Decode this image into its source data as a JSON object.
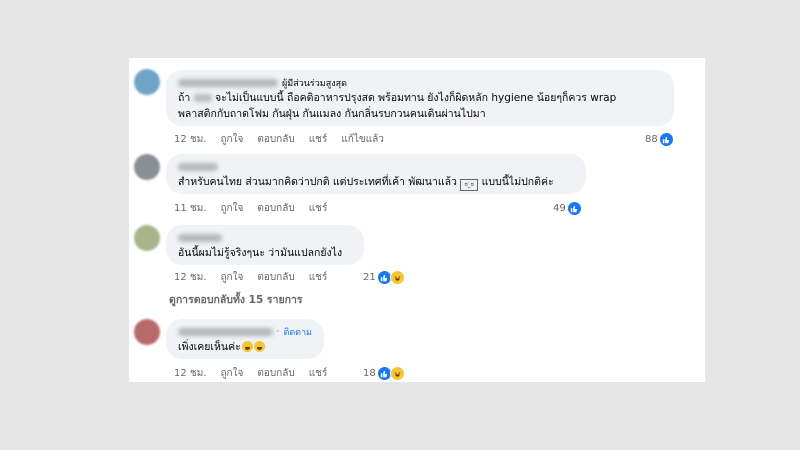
{
  "comments": [
    {
      "badge": "ผู้มีส่วนร่วมสูงสุด",
      "line1_prefix": "ถ้า",
      "line1_suffix": "จะไม่เป็นแบบนี้ ถือคติอาหารปรุงสด พร้อมทาน ยังไงก็ผิดหลัก hygiene น้อยๆก็ควร wrap",
      "line2": "พลาสติกกับถาดโฟม กันฝุ่น กันแมลง กันกลิ่นรบกวนคนเดินผ่านไปมา",
      "time": "12 ชม.",
      "like": "ถูกใจ",
      "reply": "ตอบกลับ",
      "share": "แชร์",
      "edited": "แก้ไขแล้ว",
      "reaction_count": "88",
      "avatar_color": "#6fa3c7"
    },
    {
      "line1": "สำหรับคนไทย ส่วนมากคิดว่าปกติ แต่ประเทศที่เค้า พัฒนาแล้ว",
      "kaomoji": "ಠ_ಠ",
      "line1_end": "แบบนี้ไม่ปกติค่ะ",
      "time": "11 ชม.",
      "like": "ถูกใจ",
      "reply": "ตอบกลับ",
      "share": "แชร์",
      "reaction_count": "49",
      "avatar_color": "#8a8f96"
    },
    {
      "line1": "อันนี้ผมไม่รู้จริงๆนะ ว่ามันแปลกยังไง",
      "time": "12 ชม.",
      "like": "ถูกใจ",
      "reply": "ตอบกลับ",
      "share": "แชร์",
      "reaction_count": "21",
      "avatar_color": "#a9b48a"
    },
    {
      "follow": "ติดตาม",
      "line1": "เพิ่งเคยเห็นค่ะ",
      "time": "12 ชม.",
      "like": "ถูกใจ",
      "reply": "ตอบกลับ",
      "share": "แชร์",
      "reaction_count": "18",
      "avatar_color": "#b86a6a"
    }
  ],
  "view_replies": "ดูการตอบกลับทั้ง 15 รายการ",
  "colors": {
    "like_blue": "#1877f2",
    "bubble": "#f0f2f5",
    "meta_gray": "#65676b"
  }
}
